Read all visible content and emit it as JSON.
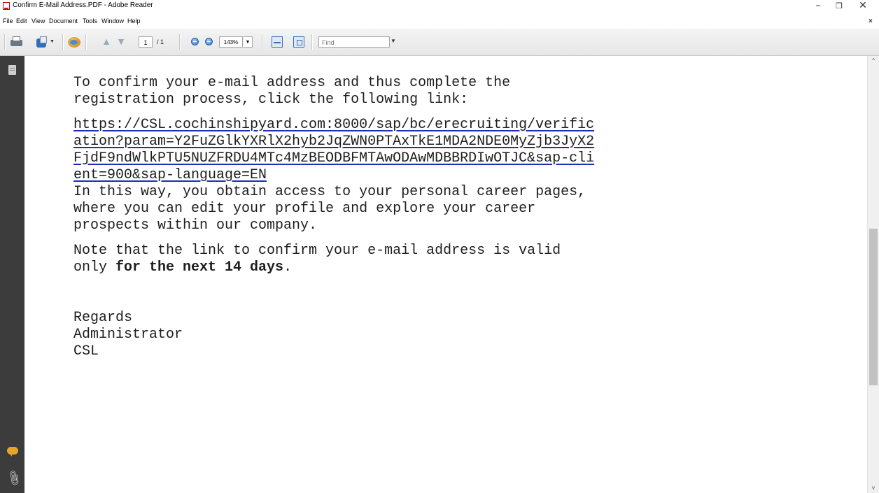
{
  "window": {
    "title": "Confirm E-Mail Address.PDF - Adobe Reader",
    "minimize_glyph": "–",
    "restore_glyph": "❐",
    "close_glyph": "✕"
  },
  "menu": {
    "items": [
      "File",
      "Edit",
      "View",
      "Document",
      "Tools",
      "Window",
      "Help"
    ],
    "close_doc_glyph": "×"
  },
  "toolbar": {
    "page_current": "1",
    "page_total": "/ 1",
    "zoom": "143%",
    "find_placeholder": "Find",
    "icons": [
      "print-icon",
      "create-pdf-icon",
      "collaborate-icon",
      "prev-page-icon",
      "next-page-icon",
      "zoom-out-icon",
      "zoom-in-icon",
      "fit-page-icon",
      "full-screen-icon"
    ]
  },
  "leftnav": {
    "icons": [
      "pages-icon",
      "comments-icon",
      "attachments-icon"
    ]
  },
  "document": {
    "para1": [
      "To confirm your e-mail address and thus complete the",
      "registration process, click the following link:"
    ],
    "link_lines": [
      "https://CSL.cochinshipyard.com:8000/sap/bc/erecruiting/verific",
      "ation?param=Y2FuZGlkYXRlX2hyb2JqZWN0PTAxTkE1MDA2NDE0MyZjb3JyX2",
      "FjdF9ndWlkPTU5NUZFRDU4MTc4MzBEODBFMTAwODAwMDBBRDIwOTJC&sap-cli",
      "ent=900&sap-language=EN"
    ],
    "para2": [
      "In this way, you obtain access to your personal career pages,",
      "where you can edit your profile and explore your career",
      "prospects within our company."
    ],
    "note_line1": "Note that the link to confirm your e-mail address is valid",
    "note_prefix": "only ",
    "note_bold": "for the next 14 days",
    "note_suffix": ".",
    "signoff": [
      "Regards",
      "Administrator",
      "CSL"
    ]
  },
  "scrollbar": {
    "up_glyph": "^",
    "down_glyph": "v"
  },
  "colors": {
    "link_underline": "#1d2fb8",
    "left_panel": "#3c3c3c"
  }
}
